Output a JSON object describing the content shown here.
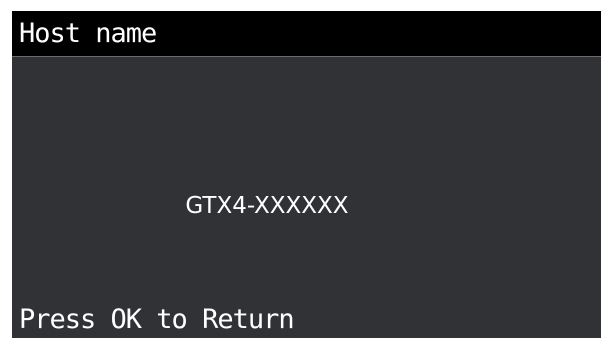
{
  "screen": {
    "title": "Host name",
    "host_name_value": "GTX4-XXXXXX",
    "footer_hint": "Press OK to Return"
  },
  "colors": {
    "title_bar_background": "#000000",
    "screen_background": "#303236",
    "text": "#ffffff"
  }
}
